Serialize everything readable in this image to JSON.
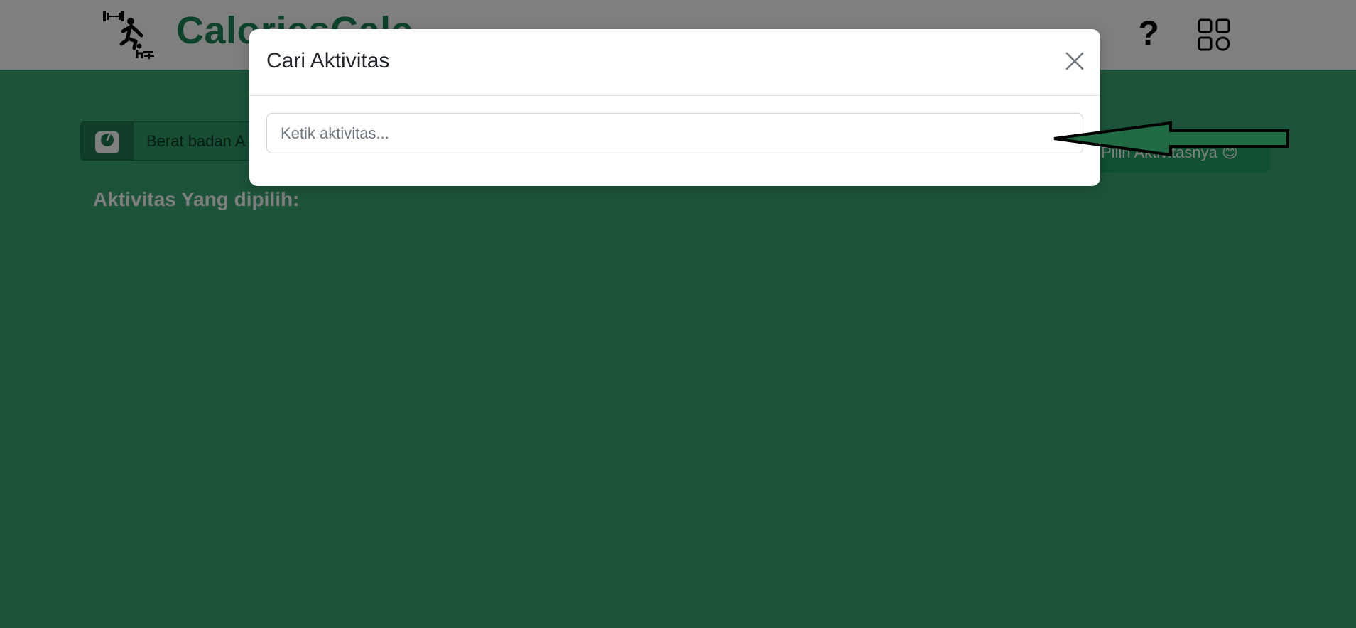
{
  "navbar": {
    "brand": "CaloriesCalc",
    "logo_icon": "fitness-activities-icon",
    "help_label": "?",
    "apps_icon": "apps-grid-icon"
  },
  "main": {
    "weight_icon": "scale-icon",
    "weight_placeholder": "Berat badan A",
    "choose_button": "Pilih Aktivitasnya 😊",
    "selected_title": "Aktivitas Yang dipilih:"
  },
  "modal": {
    "title": "Cari Aktivitas",
    "close_icon": "close-icon",
    "search_placeholder": "Ketik aktivitas...",
    "search_value": ""
  },
  "annotation": {
    "arrow_icon": "left-arrow-annotation-icon"
  },
  "colors": {
    "brand_green": "#198754",
    "page_background": "#3aa873",
    "backdrop": "rgba(0,0,0,0.5)",
    "modal_background": "#ffffff"
  }
}
